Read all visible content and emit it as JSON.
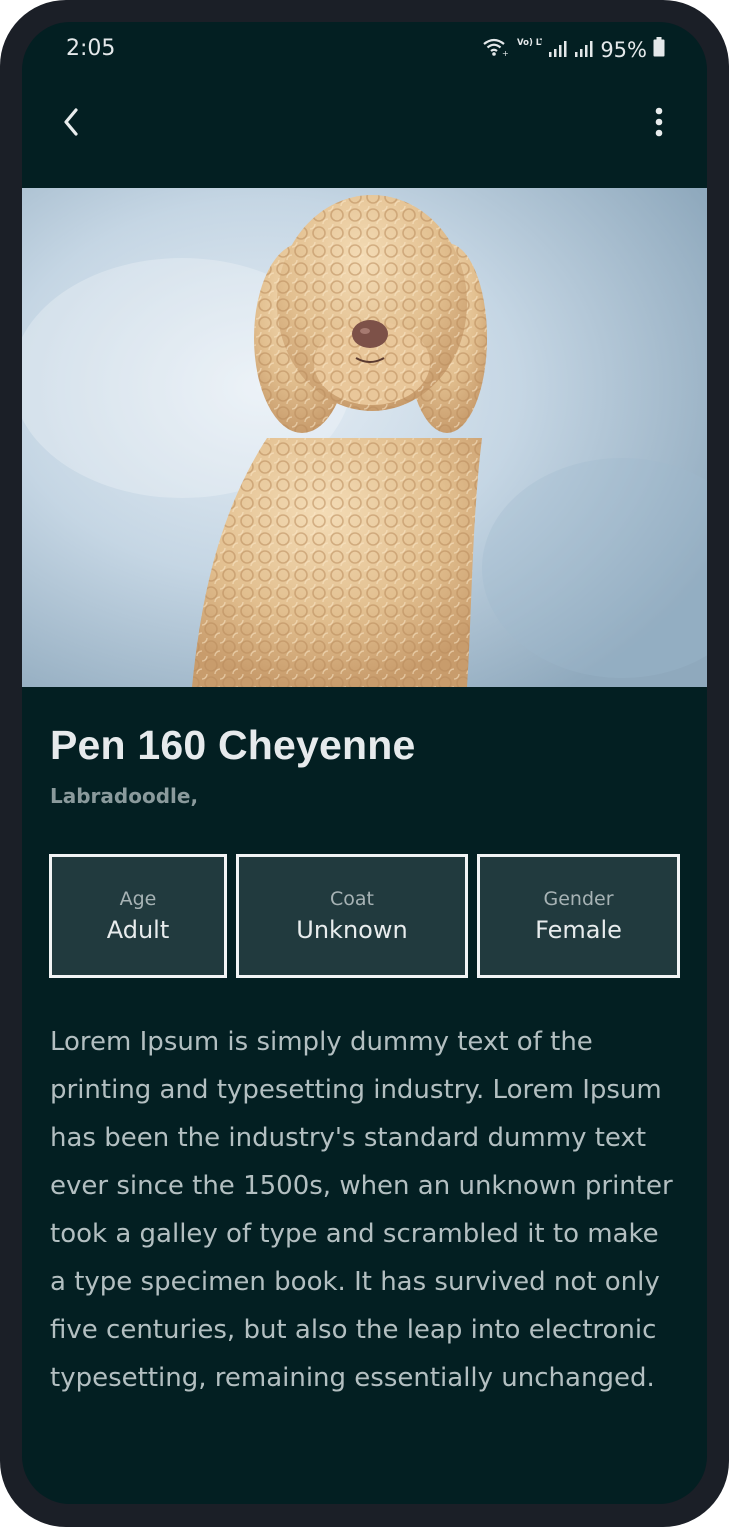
{
  "status_bar": {
    "time": "2:05",
    "network_label": "Vo) LTE1",
    "battery_percent": "95%",
    "icons": [
      "wifi-icon",
      "volte-icon",
      "signal-icon",
      "signal-icon",
      "battery-icon"
    ]
  },
  "app_bar": {
    "back_icon": "chevron-left-icon",
    "menu_icon": "more-vertical-icon"
  },
  "hero": {
    "subject": "curly apricot labradoodle photo"
  },
  "pet": {
    "name": "Pen 160 Cheyenne",
    "breed": "Labradoodle,",
    "stats": [
      {
        "label": "Age",
        "value": "Adult"
      },
      {
        "label": "Coat",
        "value": "Unknown"
      },
      {
        "label": "Gender",
        "value": "Female"
      }
    ],
    "description": "Lorem Ipsum is simply dummy text of the printing and typesetting industry. Lorem Ipsum has been the industry's standard dummy text ever since the 1500s, when an unknown printer took a galley of type and scrambled it to make a type specimen book. It has survived not only five centuries, but also the leap into electronic typesetting, remaining essentially unchanged."
  },
  "colors": {
    "background": "#031f22",
    "card_fill": "#213a3e",
    "card_border": "#f2f4f5",
    "title_text": "#e6eaec",
    "body_text": "#b3bfc1"
  }
}
